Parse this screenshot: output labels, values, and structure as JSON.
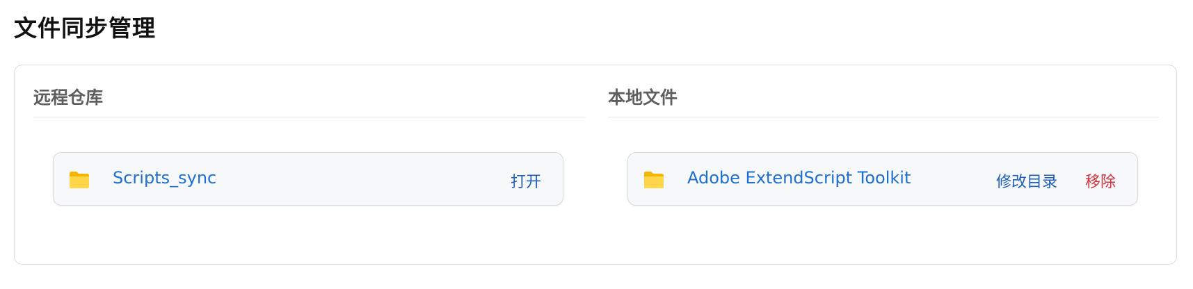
{
  "page": {
    "title": "文件同步管理"
  },
  "remote": {
    "title": "远程仓库",
    "items": [
      {
        "icon": "folder-icon",
        "name": "Scripts_sync",
        "open_label": "打开"
      }
    ]
  },
  "local": {
    "title": "本地文件",
    "items": [
      {
        "icon": "folder-icon",
        "name": "Adobe ExtendScript Toolkit",
        "edit_label": "修改目录",
        "remove_label": "移除"
      }
    ]
  },
  "colors": {
    "link_blue": "#1f6fd1",
    "action_blue": "#1f5fb8",
    "danger_red": "#d0333b",
    "folder_yellow": "#f6c23e",
    "card_bg": "#f7f8fa"
  }
}
